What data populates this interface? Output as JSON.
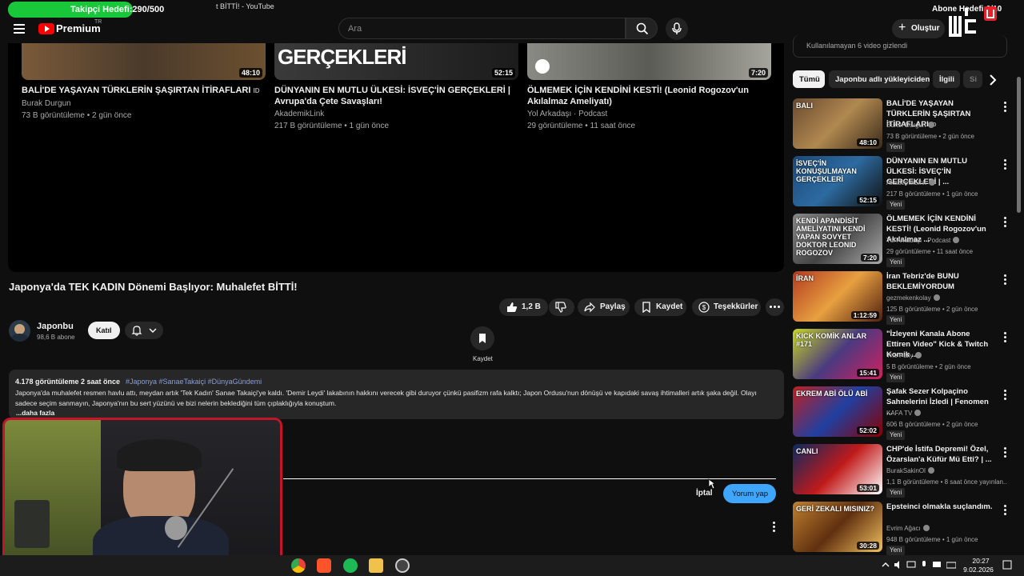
{
  "overlay": {
    "follower_goal": "Takipçi Hedefi:290/500",
    "follower_fraction": 0.58,
    "sub_goal": "Abone Hedefi:0/10",
    "window_title": "t BİTTİ! - YouTube"
  },
  "header": {
    "brand": "Premium",
    "country": "TR",
    "search_placeholder": "Ara",
    "create_label": "Oluştur"
  },
  "top_cards": [
    {
      "title": "BALİ'DE YAŞAYAN TÜRKLERİN ŞAŞIRTAN İTİRAFLARI",
      "badge": "ID",
      "channel": "Burak Durgun",
      "meta": "73 B görüntüleme • 2 gün önce",
      "duration": "48:10"
    },
    {
      "title": "DÜNYANIN EN MUTLU ÜLKESİ: İSVEÇ'İN GERÇEKLERİ | Avrupa'da Çete Savaşları!",
      "thumb_text": "GERÇEKLERİ",
      "channel": "AkademikLink",
      "meta": "217 B görüntüleme • 1 gün önce",
      "duration": "52:15"
    },
    {
      "title": "ÖLMEMEK İÇİN KENDİNİ KESTİ! (Leonid Rogozov'un Akılalmaz Ameliyatı)",
      "channel": "Yol Arkadaşı · Podcast",
      "meta": "29 görüntüleme • 11 saat önce",
      "duration": "7:20"
    }
  ],
  "video": {
    "title": "Japonya'da TEK KADIN Dönemi Başlıyor: Muhalefet BİTTİ!",
    "likes": "1,2 B",
    "share": "Paylaş",
    "save": "Kaydet",
    "thanks": "Teşekkürler",
    "channel": "Japonbu",
    "subs": "98,6 B abone",
    "join": "Katıl",
    "save_float": "Kaydet"
  },
  "description": {
    "views": "4.178 görüntüleme  2 saat önce",
    "tags": "#Japonya #SanaeTakaiçi #DünyaGündemi",
    "text": "Japonya'da muhalefet resmen havlu attı, meydan artık 'Tek Kadın' Sanae Takaiçi'ye kaldı. 'Demir Leydi' lakabının hakkını verecek gibi duruyor çünkü pasifizm rafa kalktı; Japon Ordusu'nun dönüşü ve kapıdaki savaş ihtimalleri artık şaka değil. Olayı sadece seçim sanmayın, Japonya'nın bu sert yüzünü ve bizi nelerin beklediğini tüm çıplaklığıyla konuştum.",
    "more": "...daha fazla"
  },
  "comment": {
    "cancel": "İptal",
    "submit": "Yorum yap"
  },
  "sidebar": {
    "hidden_notice": "Kullanılamayan 6 video gizlendi",
    "chips": [
      "Tümü",
      "Japonbu adlı yükleyiciden",
      "İlgili",
      "Si"
    ],
    "recs": [
      {
        "title": "BALİ'DE YAŞAYAN TÜRKLERİN ŞAŞIRTAN İTİRAFLARI",
        "badge": "ID",
        "channel": "Burak Durgun",
        "meta": "73 B görüntüleme • 2 gün önce",
        "new": "Yeni",
        "duration": "48:10",
        "thumb_text": "BALI"
      },
      {
        "title": "DÜNYANIN EN MUTLU ÜLKESİ: İSVEÇ'İN GERÇEKLERİ | ...",
        "channel": "AkademikLink",
        "meta": "217 B görüntüleme • 1 gün önce",
        "new": "Yeni",
        "duration": "52:15",
        "thumb_text": "İSVEÇ'İN KONUŞULMAYAN GERÇEKLERİ"
      },
      {
        "title": "ÖLMEMEK İÇİN KENDİNİ KESTİ! (Leonid Rogozov'un Akılalmaz ...",
        "channel": "Yol Arkadaşı · Podcast",
        "meta": "29 görüntüleme • 11 saat önce",
        "new": "Yeni",
        "duration": "7:20",
        "thumb_text": "KENDİ APANDİSİT AMELİYATINI KENDİ YAPAN SOVYET DOKTOR LEONID ROGOZOV"
      },
      {
        "title": "İran Tebriz'de BUNU BEKLEMİYORDUM",
        "channel": "gezmekenkolay",
        "meta": "125 B görüntüleme • 2 gün önce",
        "new": "Yeni",
        "duration": "1:12:59",
        "thumb_text": "İRAN"
      },
      {
        "title": "\"İzleyeni Kanala Abone Ettiren Video\" Kick & Twitch Komik ...",
        "channel": "The Pally",
        "meta": "5 B görüntüleme • 2 gün önce",
        "new": "Yeni",
        "duration": "15:41",
        "thumb_text": "KICK KOMİK ANLAR #171"
      },
      {
        "title": "Şafak Sezer Kolpaçino Sahnelerini İzledi | Fenomen ...",
        "channel": "KAFA TV",
        "meta": "606 B görüntüleme • 2 gün önce",
        "new": "Yeni",
        "duration": "52:02",
        "thumb_text": "EKREM ABİ ÖLÜ ABİ"
      },
      {
        "title": "CHP'de İstifa Depremi! Özel, Özarslan'a Küfür Mü Etti? | ...",
        "channel": "BurakSakinOl",
        "meta": "1,1 B görüntüleme • 8 saat önce yayınlan...",
        "new": "Yeni",
        "duration": "53:01",
        "thumb_text": "CANLI"
      },
      {
        "title": "Epsteinci olmakla suçlandım.",
        "channel": "Evrim Ağacı",
        "meta": "948 B görüntüleme • 1 gün önce",
        "new": "Yeni",
        "duration": "30:28",
        "thumb_text": "GERİ ZEKALI MISINIZ?"
      }
    ]
  },
  "taskbar": {
    "time": "20:27",
    "date": "9.02.2026"
  }
}
